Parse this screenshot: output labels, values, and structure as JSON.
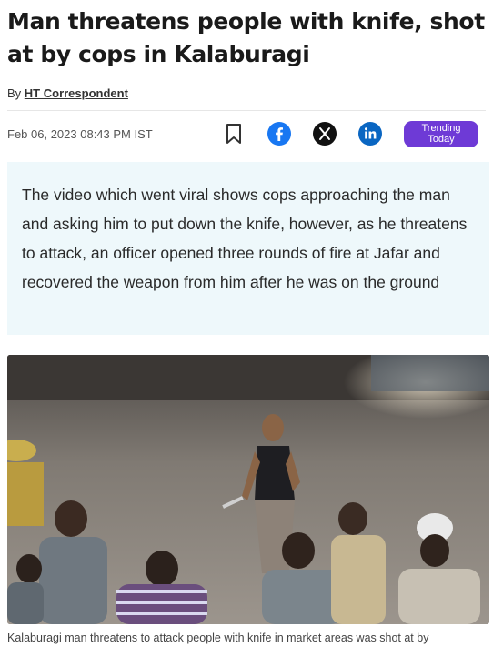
{
  "article": {
    "headline": "Man threatens people with knife, shot at by cops in Kalaburagi",
    "byline_prefix": "By",
    "author": "HT Correspondent",
    "timestamp": "Feb 06, 2023 08:43 PM IST",
    "summary": "The video which went viral shows cops approaching the man and asking him to put down the knife, however, as he threatens to attack, an officer opened three rounds of fire at Jafar and recovered the weapon from him after he was on the ground",
    "image_caption": "Kalaburagi man threatens to attack people with knife in market areas was shot at by"
  },
  "actions": {
    "bookmark_icon": "bookmark-icon",
    "facebook_icon": "facebook-icon",
    "x_icon": "x-icon",
    "linkedin_icon": "linkedin-icon",
    "trending_label_line1": "Trending",
    "trending_label_line2": "Today",
    "trending_color": "#6e3ad6"
  },
  "colors": {
    "summary_bg": "#eef8fb",
    "facebook": "#1877f2",
    "linkedin": "#0a66c2",
    "x": "#111111"
  }
}
